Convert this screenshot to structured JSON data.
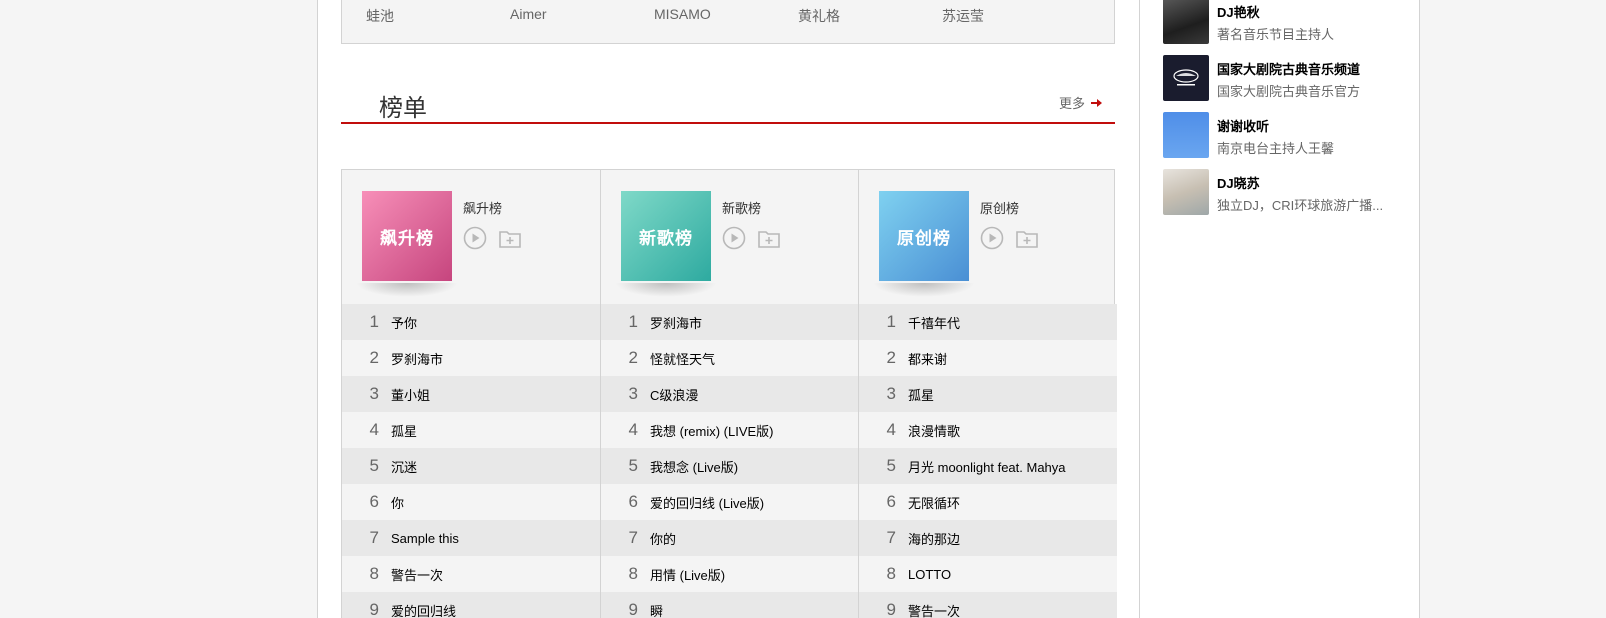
{
  "singers": [
    "蛙池",
    "Aimer",
    "MISAMO",
    "黄礼格",
    "苏运莹"
  ],
  "section": {
    "title": "榜单",
    "more_label": "更多"
  },
  "charts": [
    {
      "name": "飙升榜",
      "cover_text": "飙升榜",
      "songs": [
        "予你",
        "罗刹海市",
        "董小姐",
        "孤星",
        "沉迷",
        "你",
        "Sample this",
        "警告一次",
        "爱的回归线"
      ]
    },
    {
      "name": "新歌榜",
      "cover_text": "新歌榜",
      "songs": [
        "罗刹海市",
        "怪就怪天气",
        "C级浪漫",
        "我想 (remix) (LIVE版)",
        "我想念 (Live版)",
        "爱的回归线 (Live版)",
        "你的",
        "用情 (Live版)",
        "瞬"
      ]
    },
    {
      "name": "原创榜",
      "cover_text": "原创榜",
      "songs": [
        "千禧年代",
        "都来谢",
        "孤星",
        "浪漫情歌",
        "月光 moonlight feat. Mahya",
        "无限循环",
        "海的那边",
        "LOTTO",
        "警告一次"
      ]
    }
  ],
  "ranks": [
    "1",
    "2",
    "3",
    "4",
    "5",
    "6",
    "7",
    "8",
    "9"
  ],
  "djs": [
    {
      "name": "DJ艳秋",
      "desc": "著名音乐节目主持人"
    },
    {
      "name": "国家大剧院古典音乐频道",
      "desc": "国家大剧院古典音乐官方"
    },
    {
      "name": "谢谢收听",
      "desc": "南京电台主持人王馨"
    },
    {
      "name": "DJ晓苏",
      "desc": "独立DJ，CRI环球旅游广播..."
    }
  ],
  "colors": {
    "accent": "#c10d0c",
    "row_odd": "#e8e8e8",
    "row_even": "#f4f4f4"
  }
}
